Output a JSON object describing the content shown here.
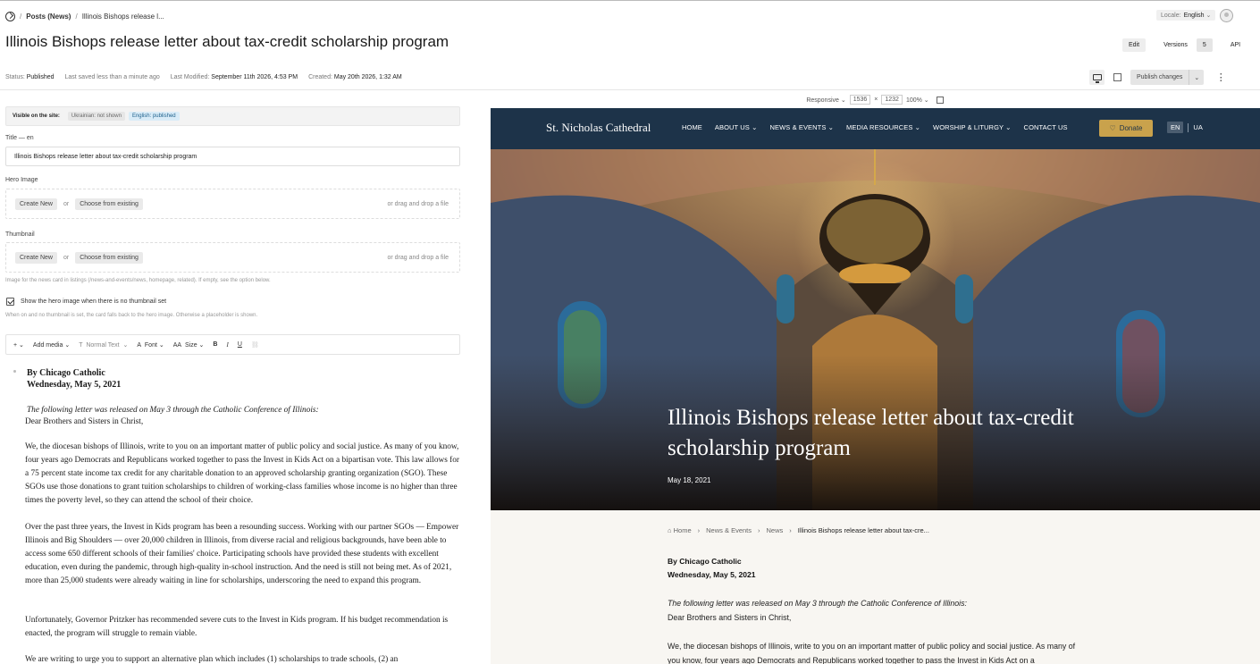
{
  "breadcrumbs": {
    "sep": "/",
    "section": "Posts (News)",
    "current": "Illinois Bishops release l..."
  },
  "locale": {
    "label": "Locale:",
    "value": "English"
  },
  "title": "Illinois Bishops release letter about tax-credit scholarship program",
  "header_tabs": {
    "edit": "Edit",
    "versions": "Versions",
    "versions_count": "5",
    "api": "API"
  },
  "status": {
    "status_label": "Status:",
    "status_value": "Published",
    "saved": "Last saved less than a minute ago",
    "modified_label": "Last Modified:",
    "modified_value": "September 11th 2026, 4:53 PM",
    "created_label": "Created:",
    "created_value": "May 20th 2026, 1:32 AM"
  },
  "publish": {
    "label": "Publish changes",
    "caret": "⌄",
    "more": "⋮"
  },
  "visibility": {
    "label": "Visible on the site:",
    "uk": "Ukrainian: not shown",
    "en": "English: published"
  },
  "fields": {
    "title_label": "Title — en",
    "title_value": "Illinois Bishops release letter about tax-credit scholarship program",
    "hero_label": "Hero Image",
    "thumb_label": "Thumbnail",
    "create_new": "Create New",
    "or": "or",
    "choose_existing": "Choose from existing",
    "drag": "or drag and drop a file",
    "thumb_help": "Image for the news card in listings (/news-and-events/news, homepage, related). If empty, see the option below.",
    "checkbox_label": "Show the hero image when there is no thumbnail set",
    "checkbox_help": "When on and no thumbnail is set, the card falls back to the hero image. Otherwise a placeholder is shown."
  },
  "toolbar": {
    "plus": "+ ⌄",
    "add_media": "Add media ⌄",
    "text_icon": "T",
    "style": "Normal Text",
    "style_caret": "⌄",
    "font_icon": "A",
    "font": "Font ⌄",
    "size_icon": "AA",
    "size": "Size ⌄",
    "bold": "B",
    "italic": "I",
    "underline": "U",
    "link": "⛓"
  },
  "article": {
    "author": "By Chicago Catholic",
    "date": "Wednesday, May 5, 2021",
    "intro": "The following letter was released on May 3 through the Catholic Conference of Illinois:",
    "greeting": "Dear Brothers and Sisters in Christ,",
    "p1": "We, the diocesan bishops of Illinois, write to you on an important matter of public policy and social justice. As many of you know, four years ago Democrats and Republicans worked together to pass the Invest in Kids Act on a bipartisan vote. This law allows for a 75 percent state income tax credit for any charitable donation to an approved scholarship granting organization (SGO). These SGOs use those donations to grant tuition scholarships to children of working-class families whose income is no higher than three times the poverty level, so they can attend the school of their choice.",
    "p2": "Over the past three years, the Invest in Kids program has been a resounding success. Working with our partner SGOs — Empower Illinois and Big Shoulders — over 20,000 children in Illinois, from diverse racial and religious backgrounds, have been able to access some 650 different schools of their families' choice. Participating schools have provided these students with excellent education, even during the pandemic, through high-quality in-school instruction. And the need is still not being met. As of 2021, more than 25,000 students were already waiting in line for scholarships, underscoring the need to expand this program.",
    "p3": " Unfortunately, Governor Pritzker has recommended severe cuts to the Invest in Kids program. If his budget recommendation is enacted, the program will struggle to remain viable.",
    "p4": "We are writing to urge you to support an alternative plan which includes (1) scholarships to trade schools, (2) an",
    "preview_p1": "We, the diocesan bishops of Illinois, write to you on an important matter of public policy and social justice. As many of you know, four years ago Democrats and Republicans worked together to pass the Invest in Kids Act on a"
  },
  "preview_bar": {
    "mode": "Responsive ⌄",
    "width": "1536",
    "x": "×",
    "height": "1232",
    "zoom": "100% ⌄"
  },
  "site": {
    "brand": "St. Nicholas Cathedral",
    "nav": [
      "HOME",
      "ABOUT US ⌄",
      "NEWS & EVENTS ⌄",
      "MEDIA RESOURCES ⌄",
      "WORSHIP & LITURGY ⌄",
      "CONTACT US"
    ],
    "donate": "Donate",
    "lang_en": "EN",
    "lang_ua": "UA",
    "hero_title": "Illinois Bishops release letter about tax-credit scholarship program",
    "hero_date": "May 18, 2021",
    "crumbs": [
      "Home",
      "News & Events",
      "News",
      "Illinois Bishops release letter about tax-cre..."
    ],
    "crumb_sep": "›"
  },
  "colors": {
    "nav_bg": "#1d3349",
    "donate": "#c9a24c",
    "published_chip": "#d9ecf8"
  }
}
